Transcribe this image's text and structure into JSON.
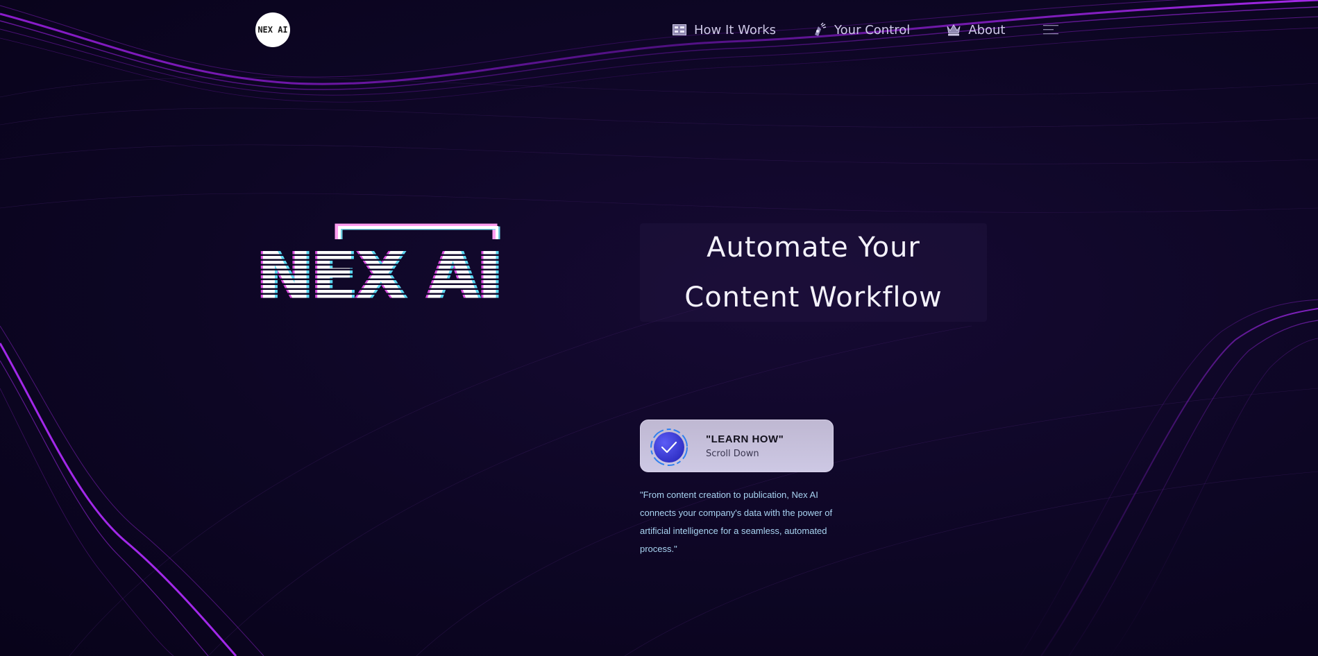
{
  "brand": {
    "badge_text": "NEX AI",
    "wordmark_text": "NEX AI"
  },
  "nav": {
    "items": [
      {
        "label": "How It Works",
        "icon": "grid-icon"
      },
      {
        "label": "Your Control",
        "icon": "control-icon"
      },
      {
        "label": "About",
        "icon": "crown-icon"
      }
    ],
    "menu_icon": "hamburger-menu-icon"
  },
  "hero": {
    "headline_line1": "Automate Your",
    "headline_line2": "Content Workflow"
  },
  "cta": {
    "title": "\"LEARN HOW\"",
    "subtitle": "Scroll Down",
    "icon": "checkmark-badge-icon"
  },
  "quote": {
    "text": "\"From content creation to publication, Nex AI connects your company's data with the power of artificial intelligence for a seamless, automated process.\""
  },
  "colors": {
    "background": "#0c0620",
    "accent_purple": "#b026ff",
    "quote_text": "#a9d4f2",
    "cta_blue": "#3b3fe0"
  }
}
